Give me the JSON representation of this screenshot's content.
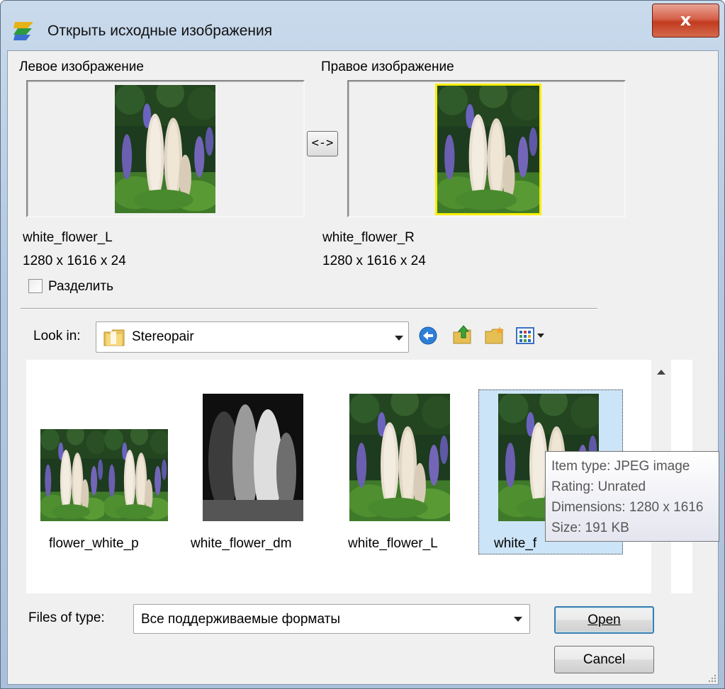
{
  "window": {
    "title": "Открыть исходные изображения",
    "close_label": "x"
  },
  "preview": {
    "left_heading": "Левое изображение",
    "right_heading": "Правое изображение",
    "swap_label": "<->",
    "left_name": "white_flower_L",
    "left_dims": "1280 x 1616 x 24",
    "right_name": "white_flower_R",
    "right_dims": "1280 x 1616 x 24",
    "split_label": "Разделить",
    "split_checked": false,
    "selection_color": "#ffee00"
  },
  "lookin": {
    "label": "Look in:",
    "value": "Stereopair",
    "icons": [
      "folder-icon",
      "back-icon",
      "up-folder-icon",
      "new-folder-icon",
      "view-menu-icon"
    ]
  },
  "files": [
    {
      "name": "flower_white_p",
      "kind": "stereo-pair"
    },
    {
      "name": "white_flower_dm",
      "kind": "depth-map"
    },
    {
      "name": "white_flower_L",
      "kind": "photo"
    },
    {
      "name": "white_f",
      "kind": "photo",
      "selected": true
    }
  ],
  "tooltip": {
    "lines": [
      "Item type: JPEG image",
      "Rating: Unrated",
      "Dimensions: 1280 x 1616",
      "Size: 191 KB"
    ]
  },
  "filetype": {
    "label": "Files of type:",
    "value": "Все поддерживаемые форматы"
  },
  "buttons": {
    "open": "Open",
    "cancel": "Cancel"
  }
}
